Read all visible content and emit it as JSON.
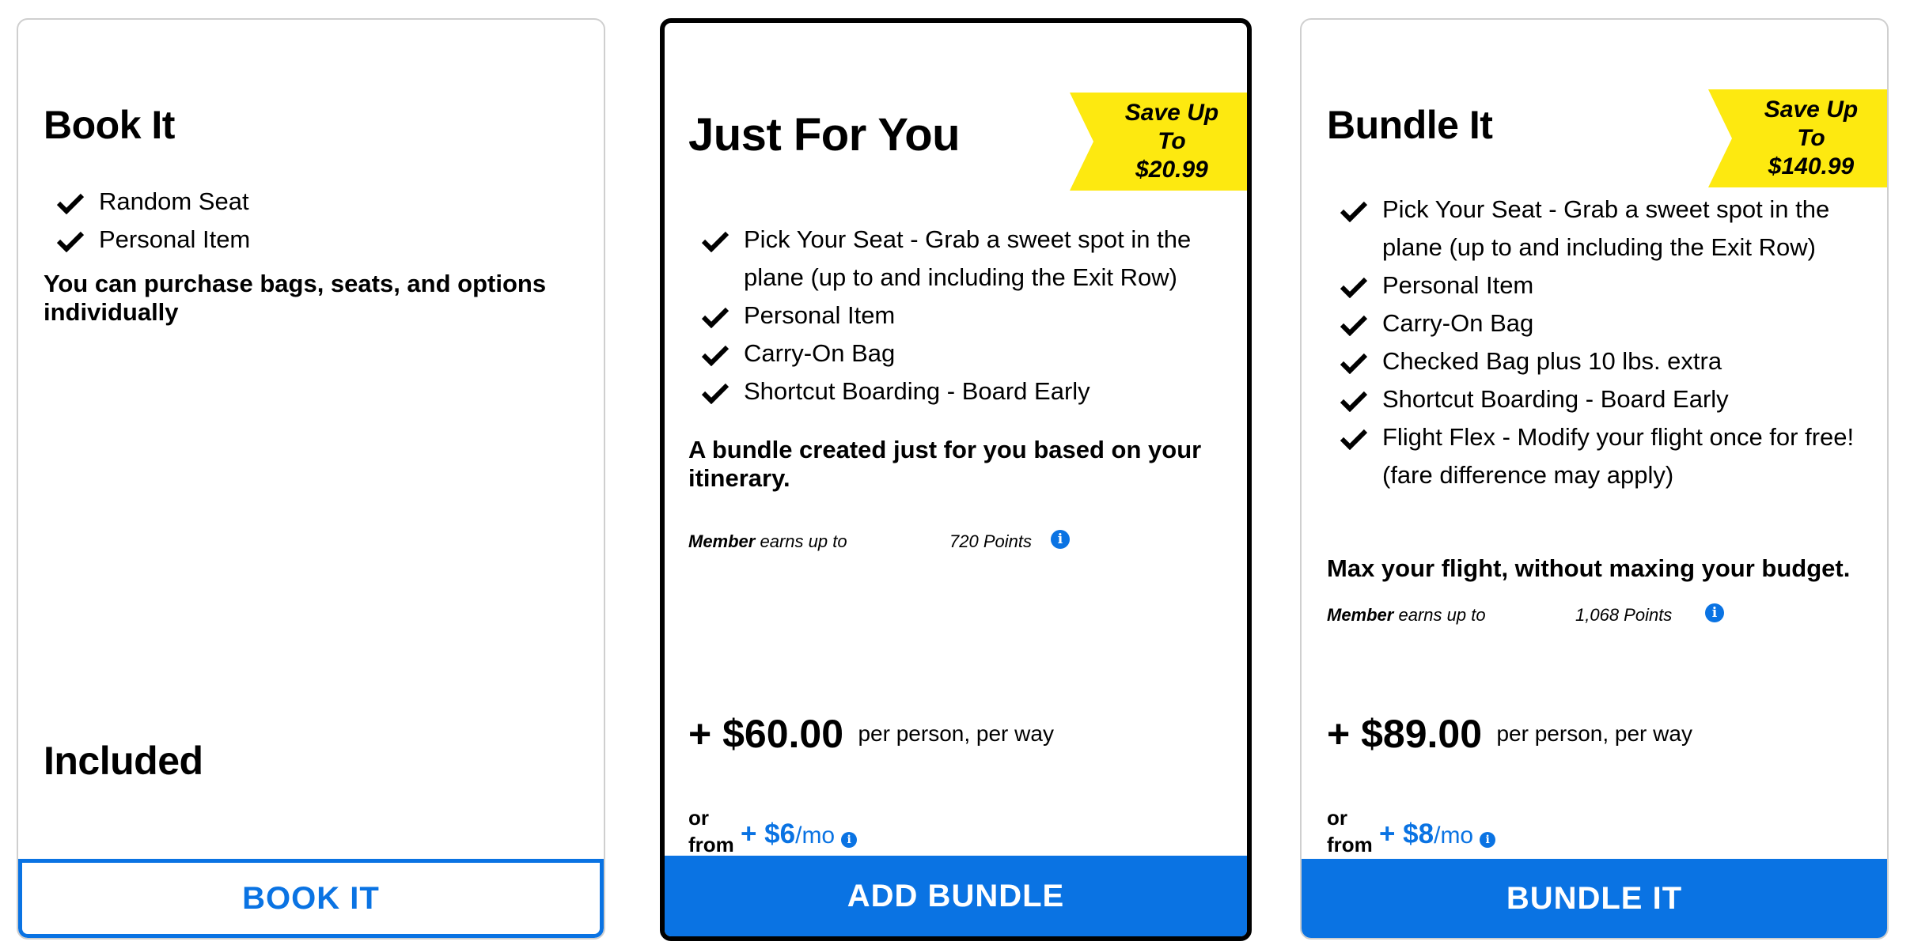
{
  "cards": {
    "book": {
      "title": "Book It",
      "features": [
        "Random Seat",
        "Personal Item"
      ],
      "description": "You can purchase bags, seats, and options individually",
      "included_label": "Included",
      "cta": "BOOK IT"
    },
    "jfy": {
      "title": "Just For You",
      "ribbon_line1": "Save Up To",
      "ribbon_line2": "$20.99",
      "features": [
        "Pick Your Seat - Grab a sweet spot in the plane (up to and including the Exit Row)",
        "Personal Item",
        "Carry-On Bag",
        "Shortcut Boarding - Board Early"
      ],
      "description": "A bundle created just for you based on your itinerary.",
      "points_member": "Member",
      "points_earns": "earns up to",
      "points_value": "720 Points",
      "price": "+ $60.00",
      "price_suffix": "per person, per way",
      "or_label": "or",
      "from_label": "from",
      "monthly_amount": "+ $6",
      "monthly_suffix": "/mo",
      "cta": "ADD BUNDLE"
    },
    "bundle": {
      "title": "Bundle It",
      "ribbon_line1": "Save Up To",
      "ribbon_line2": "$140.99",
      "features": [
        "Pick Your Seat - Grab a sweet spot in the plane (up to and including the Exit Row)",
        "Personal Item",
        "Carry-On Bag",
        "Checked Bag plus 10 lbs. extra",
        "Shortcut Boarding - Board Early",
        "Flight Flex - Modify your flight once for free! (fare difference may apply)"
      ],
      "description": "Max your flight, without maxing your budget.",
      "points_member": "Member",
      "points_earns": "earns up to",
      "points_value": "1,068 Points",
      "price": "+ $89.00",
      "price_suffix": "per person, per way",
      "or_label": "or",
      "from_label": "from",
      "monthly_amount": "+ $8",
      "monthly_suffix": "/mo",
      "cta": "BUNDLE IT"
    }
  },
  "icons": {
    "feature": "check-icon",
    "info": "info-icon"
  },
  "colors": {
    "accent": "#0a73e3",
    "ribbon": "#fde910",
    "selected_border": "#000000"
  }
}
